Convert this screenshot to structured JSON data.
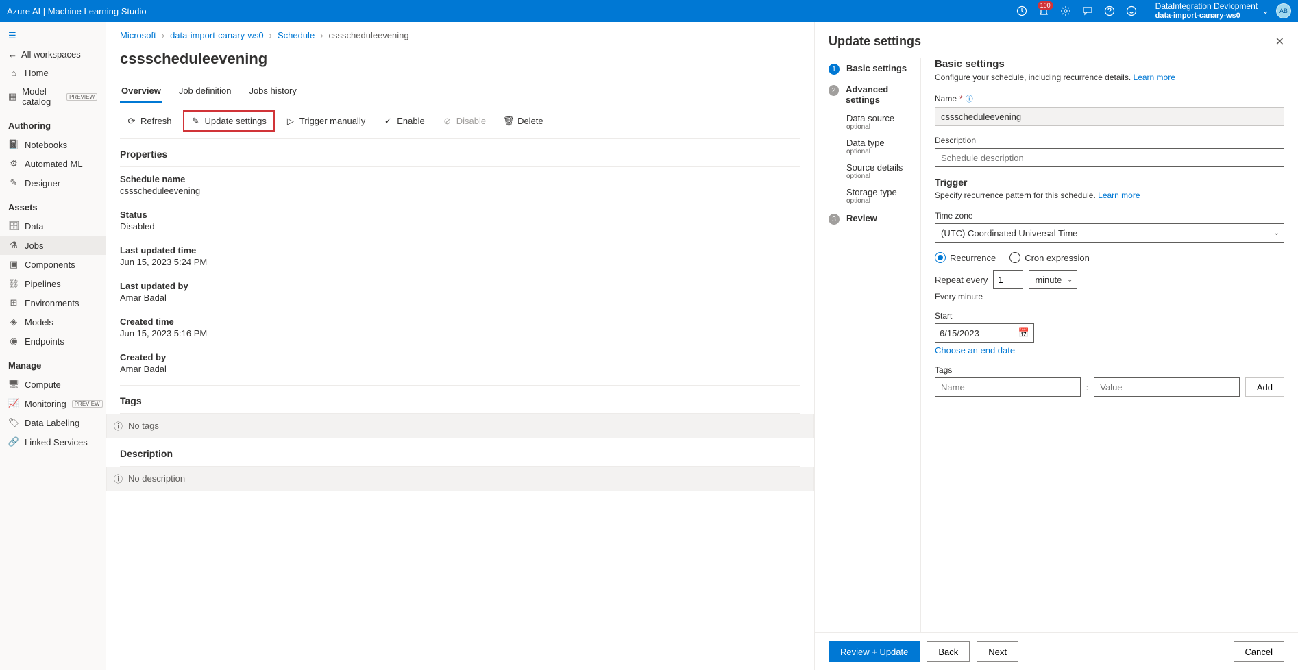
{
  "topbar": {
    "title": "Azure AI | Machine Learning Studio",
    "notification_count": "100",
    "directory": "DataIntegration Devlopment",
    "workspace": "data-import-canary-ws0",
    "avatar_initials": "AB"
  },
  "nav": {
    "back": "All workspaces",
    "home": "Home",
    "model_catalog": "Model catalog",
    "preview_badge": "Preview",
    "authoring": "Authoring",
    "notebooks": "Notebooks",
    "automated_ml": "Automated ML",
    "designer": "Designer",
    "assets": "Assets",
    "data": "Data",
    "jobs": "Jobs",
    "components": "Components",
    "pipelines": "Pipelines",
    "environments": "Environments",
    "models": "Models",
    "endpoints": "Endpoints",
    "manage": "Manage",
    "compute": "Compute",
    "monitoring": "Monitoring",
    "data_labeling": "Data Labeling",
    "linked_services": "Linked Services"
  },
  "breadcrumb": {
    "items": [
      "Microsoft",
      "data-import-canary-ws0",
      "Schedule"
    ],
    "current": "cssscheduleevening"
  },
  "page": {
    "title": "cssscheduleevening",
    "tabs": {
      "overview": "Overview",
      "job_def": "Job definition",
      "jobs_hist": "Jobs history"
    }
  },
  "toolbar": {
    "refresh": "Refresh",
    "update": "Update settings",
    "trigger": "Trigger manually",
    "enable": "Enable",
    "disable": "Disable",
    "delete": "Delete"
  },
  "properties": {
    "heading": "Properties",
    "rows": {
      "schedule_name_l": "Schedule name",
      "schedule_name_v": "cssscheduleevening",
      "status_l": "Status",
      "status_v": "Disabled",
      "last_updated_l": "Last updated time",
      "last_updated_v": "Jun 15, 2023 5:24 PM",
      "updated_by_l": "Last updated by",
      "updated_by_v": "Amar Badal",
      "created_time_l": "Created time",
      "created_time_v": "Jun 15, 2023 5:16 PM",
      "created_by_l": "Created by",
      "created_by_v": "Amar Badal"
    },
    "tags_heading": "Tags",
    "no_tags": "No tags",
    "desc_heading": "Description",
    "no_desc": "No description"
  },
  "panel": {
    "title": "Update settings",
    "steps": {
      "basic": "Basic settings",
      "advanced": "Advanced settings",
      "review": "Review",
      "data_source": "Data source",
      "data_type": "Data type",
      "source_details": "Source details",
      "storage_type": "Storage type",
      "optional": "optional"
    },
    "form": {
      "basic_heading": "Basic settings",
      "basic_desc": "Configure your schedule, including recurrence details.",
      "learn_more": "Learn more",
      "name_label": "Name",
      "name_value": "cssscheduleevening",
      "description_label": "Description",
      "description_placeholder": "Schedule description",
      "trigger_heading": "Trigger",
      "trigger_desc": "Specify recurrence pattern for this schedule.",
      "tz_label": "Time zone",
      "tz_value": "(UTC) Coordinated Universal Time",
      "recurrence": "Recurrence",
      "cron": "Cron expression",
      "repeat_every": "Repeat every",
      "repeat_value": "1",
      "repeat_unit": "minute",
      "every_hint": "Every minute",
      "start_label": "Start",
      "start_value": "6/15/2023",
      "choose_end": "Choose an end date",
      "tags_label": "Tags",
      "tag_name_placeholder": "Name",
      "tag_value_placeholder": "Value",
      "add_btn": "Add"
    },
    "footer": {
      "review_update": "Review + Update",
      "back": "Back",
      "next": "Next",
      "cancel": "Cancel"
    }
  }
}
